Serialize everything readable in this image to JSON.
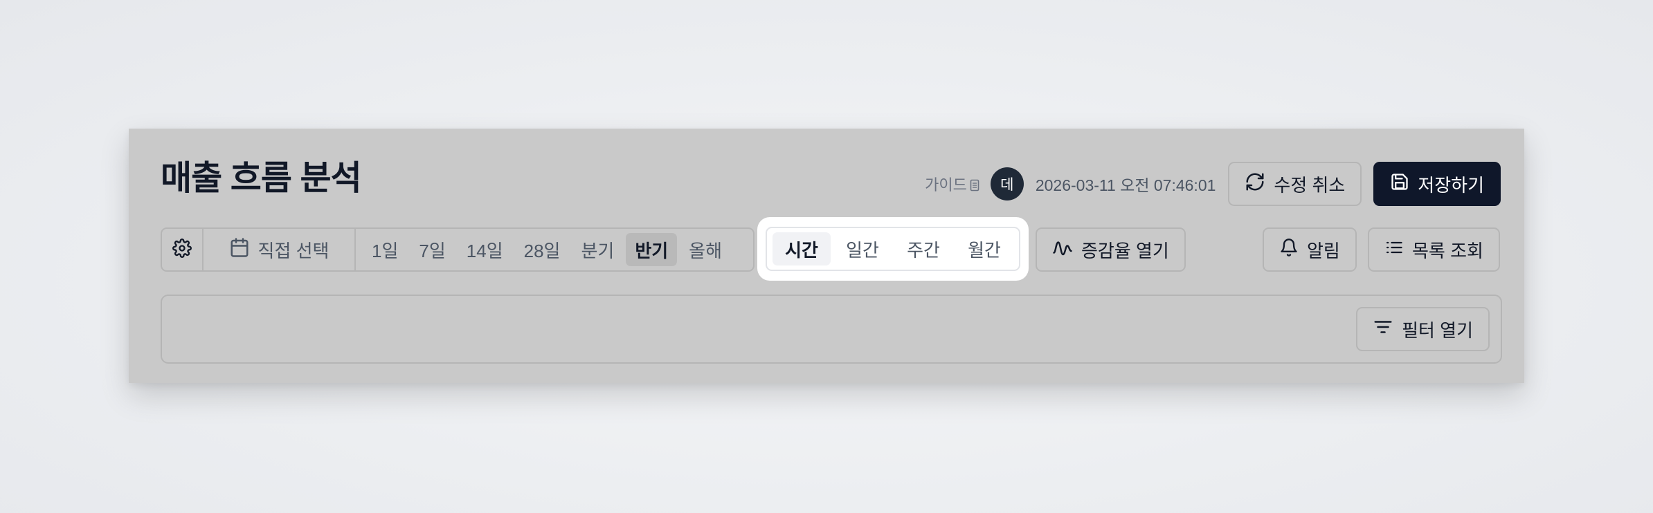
{
  "page": {
    "title": "매출 흐름 분석"
  },
  "header": {
    "guide_label": "가이드",
    "avatar_initial": "데",
    "timestamp": "2026-03-11 오전 07:46:01",
    "cancel_label": "수정 취소",
    "save_label": "저장하기"
  },
  "toolbar": {
    "custom_range_label": "직접 선택",
    "presets": [
      {
        "label": "1일",
        "active": false
      },
      {
        "label": "7일",
        "active": false
      },
      {
        "label": "14일",
        "active": false
      },
      {
        "label": "28일",
        "active": false
      },
      {
        "label": "분기",
        "active": false
      },
      {
        "label": "반기",
        "active": true
      },
      {
        "label": "올해",
        "active": false
      }
    ],
    "granularity": [
      {
        "label": "시간",
        "active": true
      },
      {
        "label": "일간",
        "active": false
      },
      {
        "label": "주간",
        "active": false
      },
      {
        "label": "월간",
        "active": false
      }
    ],
    "growth_label": "증감율 열기",
    "alert_label": "알림",
    "list_label": "목록 조회"
  },
  "filters": {
    "open_label": "필터 열기"
  },
  "icons": {
    "guide": "document-icon",
    "settings": "gear-icon",
    "calendar": "calendar-icon",
    "cancel": "refresh-icon",
    "save": "save-icon",
    "growth": "wave-icon",
    "alert": "bell-icon",
    "list": "list-icon",
    "filter": "filter-icon"
  },
  "colors": {
    "overlay": "#c9c9c9",
    "primary_dark": "#0f172a",
    "spotlight": "#ffffff"
  }
}
